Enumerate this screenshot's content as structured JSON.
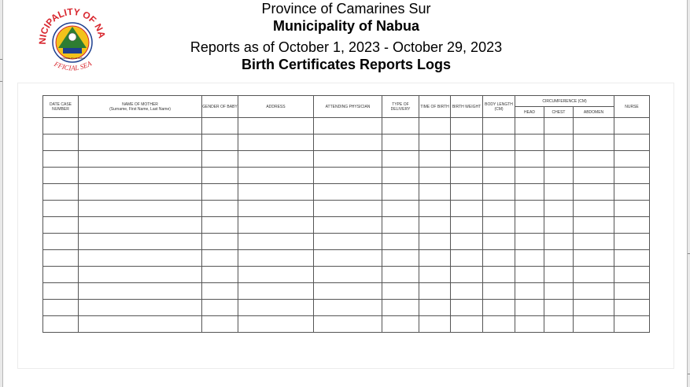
{
  "seal": {
    "top_text": "MUNICIPALITY OF NABUA",
    "bottom_text": "OFFICIAL SEAL",
    "inner_text": "MUNICIPALITY OF NABUA",
    "colors": {
      "red": "#d8262e",
      "blue": "#1d3f8f",
      "yellow": "#f2c21b",
      "green": "#2e7d32"
    }
  },
  "header": {
    "province": "Province of Camarines Sur",
    "municipality": "Municipality of Nabua",
    "reports_period": "Reports as of October 1, 2023 - October 29, 2023",
    "title": "Birth Certificates Reports Logs"
  },
  "table": {
    "columns": {
      "case_number": "DATE CASE NUMBER",
      "mother_name": "NAME OF MOTHER",
      "mother_name_sub": "(Surname, First Name, Last Name)",
      "gender": "GENDER OF BABY",
      "address": "ADDRESS",
      "physician": "ATTENDING PHYSICIAN",
      "delivery": "TYPE OF DELIVERY",
      "time_of_birth": "TIME OF BIRTH",
      "birth_weight": "BIRTH WEIGHT",
      "body_length": "BODY LENGTH (CM)",
      "circumference": "CIRCUMFERENCE (CM)",
      "head": "HEAD",
      "chest": "CHEST",
      "abdomen": "ABDOMEN",
      "nurse": "NURSE"
    },
    "empty_rows": 13
  }
}
